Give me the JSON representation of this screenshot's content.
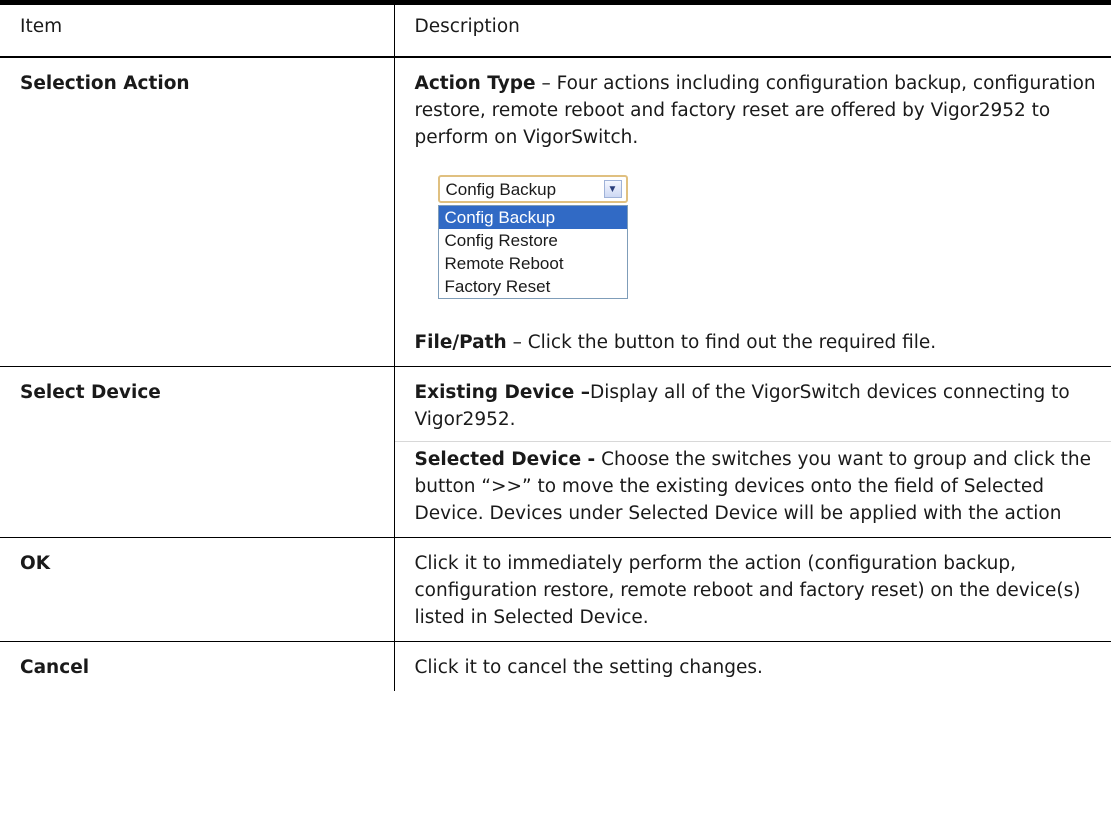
{
  "header": {
    "item": "Item",
    "description": "Description"
  },
  "rows": [
    {
      "item": "Selection Action",
      "action_type_label": "Action Type",
      "action_type_text": " – Four actions including configuration backup, configuration restore, remote reboot and factory reset are offered by Vigor2952 to perform on VigorSwitch.",
      "dropdown": {
        "selected": "Config Backup",
        "options": [
          "Config Backup",
          "Config Restore",
          "Remote Reboot",
          "Factory Reset"
        ]
      },
      "file_path_label": "File/Path",
      "file_path_text": " – Click the button to find out the required file."
    },
    {
      "item": "Select Device",
      "existing_label": "Existing Device –",
      "existing_text": "Display all of the VigorSwitch devices connecting to Vigor2952.",
      "selected_label": "Selected Device -",
      "selected_text": " Choose the switches you want to group and click the button “>>” to move the existing devices onto the field of Selected Device. Devices under Selected Device will be applied with the action"
    },
    {
      "item": "OK",
      "text": "Click it to immediately perform the action (configuration backup, configuration restore, remote reboot and factory reset) on the device(s) listed in Selected Device."
    },
    {
      "item": "Cancel",
      "text": "Click it to cancel the setting changes."
    }
  ]
}
